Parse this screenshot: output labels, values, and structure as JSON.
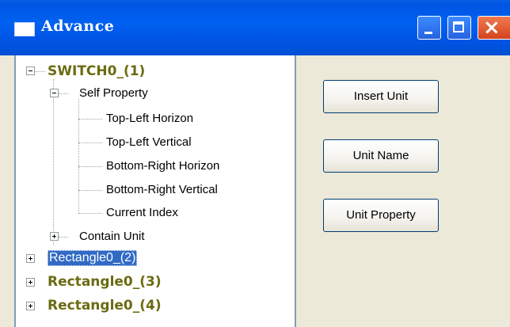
{
  "window": {
    "title": "Advance",
    "icon": "window-icon",
    "controls": {
      "minimize": "minimize-icon",
      "maximize": "maximize-icon",
      "close": "close-icon"
    },
    "colors": {
      "titlebar": "#0055e5",
      "close": "#d4431d",
      "selection": "#316ac5",
      "bold_node_text": "#6b6b12"
    }
  },
  "tree": {
    "root": {
      "label": "SWITCH0_(1)",
      "expanded": true
    },
    "self_property": {
      "label": "Self Property",
      "expanded": true,
      "children": [
        "Top-Left Horizon",
        "Top-Left Vertical",
        "Bottom-Right Horizon",
        "Bottom-Right Vertical",
        "Current Index"
      ]
    },
    "contain_unit": {
      "label": "Contain Unit",
      "expanded": false
    },
    "siblings": [
      {
        "label": "Rectangle0_(2)",
        "selected": true
      },
      {
        "label": "Rectangle0_(3)",
        "selected": false
      },
      {
        "label": "Rectangle0_(4)",
        "selected": false
      }
    ]
  },
  "buttons": {
    "insert_unit": "Insert Unit",
    "unit_name": "Unit Name",
    "unit_property": "Unit Property"
  }
}
